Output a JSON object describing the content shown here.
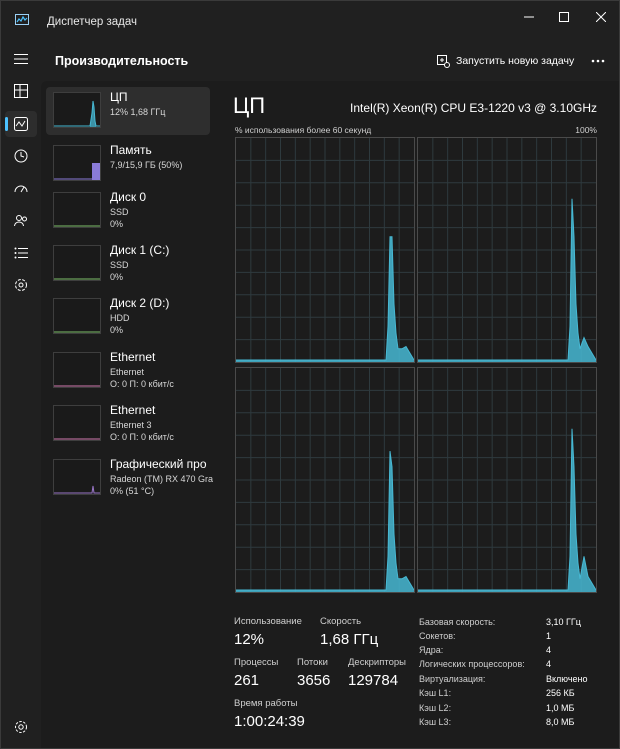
{
  "window": {
    "title": "Диспетчер задач"
  },
  "header": {
    "title": "Производительность",
    "run_task_label": "Запустить новую задачу"
  },
  "devices": [
    {
      "name": "ЦП",
      "sub1": "12%  1,68 ГГц",
      "sub2": ""
    },
    {
      "name": "Память",
      "sub1": "7,9/15,9 ГБ (50%)",
      "sub2": ""
    },
    {
      "name": "Диск 0",
      "sub1": "SSD",
      "sub2": "0%"
    },
    {
      "name": "Диск 1 (C:)",
      "sub1": "SSD",
      "sub2": "0%"
    },
    {
      "name": "Диск 2 (D:)",
      "sub1": "HDD",
      "sub2": "0%"
    },
    {
      "name": "Ethernet",
      "sub1": "Ethernet",
      "sub2": "О: 0 П: 0 кбит/с"
    },
    {
      "name": "Ethernet",
      "sub1": "Ethernet 3",
      "sub2": "О: 0 П: 0 кбит/с"
    },
    {
      "name": "Графический про",
      "sub1": "Radeon (TM) RX 470 Gra",
      "sub2": "0%  (51 °C)"
    }
  ],
  "detail": {
    "title": "ЦП",
    "model": "Intel(R) Xeon(R) CPU E3-1220 v3 @ 3.10GHz",
    "graph_label": "% использования более 60 секунд",
    "graph_max": "100%"
  },
  "stats": {
    "usage_label": "Использование",
    "usage_value": "12%",
    "speed_label": "Скорость",
    "speed_value": "1,68 ГГц",
    "processes_label": "Процессы",
    "processes_value": "261",
    "threads_label": "Потоки",
    "threads_value": "3656",
    "handles_label": "Дескрипторы",
    "handles_value": "129784",
    "uptime_label": "Время работы",
    "uptime_value": "1:00:24:39"
  },
  "specs": [
    {
      "label": "Базовая скорость:",
      "value": "3,10 ГГц"
    },
    {
      "label": "Сокетов:",
      "value": "1"
    },
    {
      "label": "Ядра:",
      "value": "4"
    },
    {
      "label": "Логических процессоров:",
      "value": "4"
    },
    {
      "label": "Виртуализация:",
      "value": "Включено"
    },
    {
      "label": "Кэш L1:",
      "value": "256 КБ"
    },
    {
      "label": "Кэш L2:",
      "value": "1,0 МБ"
    },
    {
      "label": "Кэш L3:",
      "value": "8,0 МБ"
    }
  ],
  "colors": {
    "cpu": "#47b9d4",
    "memory": "#8a7bd8",
    "disk": "#7fc06a",
    "network": "#d27bb0",
    "gpu": "#9a76c8",
    "accent": "#4cc2ff"
  },
  "icons": {
    "nav": [
      "hamburger-icon",
      "processes-icon",
      "performance-icon",
      "history-icon",
      "startup-icon",
      "users-icon",
      "details-icon",
      "services-icon",
      "settings-icon"
    ]
  }
}
